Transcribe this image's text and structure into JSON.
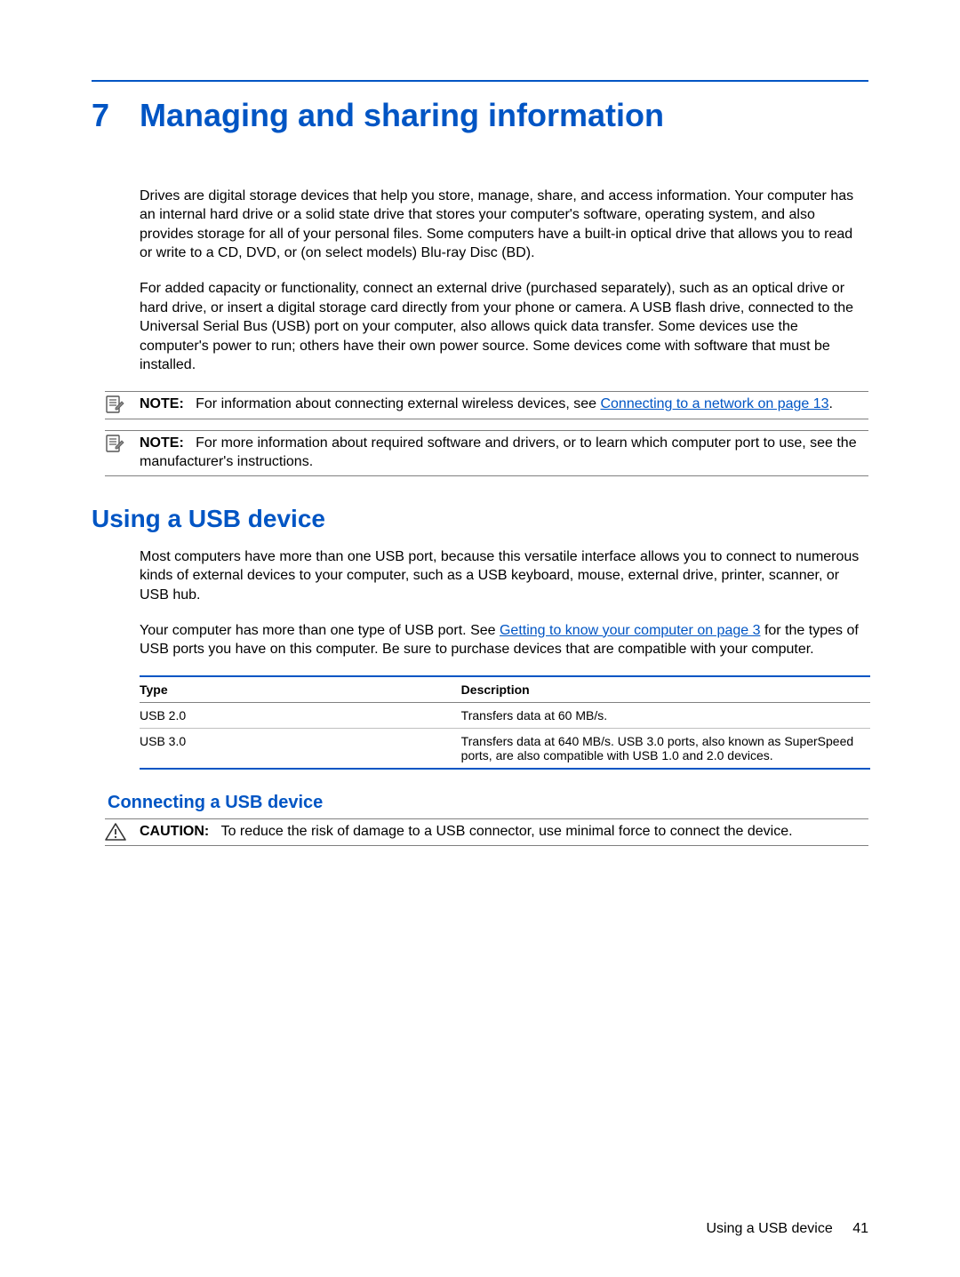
{
  "chapter": {
    "number": "7",
    "title": "Managing and sharing information"
  },
  "paragraphs": {
    "p1": "Drives are digital storage devices that help you store, manage, share, and access information. Your computer has an internal hard drive or a solid state drive that stores your computer's software, operating system, and also provides storage for all of your personal files. Some computers have a built-in optical drive that allows you to read or write to a CD, DVD, or (on select models) Blu-ray Disc (BD).",
    "p2": "For added capacity or functionality, connect an external drive (purchased separately), such as an optical drive or hard drive, or insert a digital storage card directly from your phone or camera. A USB flash drive, connected to the Universal Serial Bus (USB) port on your computer, also allows quick data transfer. Some devices use the computer's power to run; others have their own power source. Some devices come with software that must be installed."
  },
  "notes": [
    {
      "label": "NOTE:",
      "text_before": "For information about connecting external wireless devices, see ",
      "link": "Connecting to a network on page 13",
      "text_after": "."
    },
    {
      "label": "NOTE:",
      "text_full": "For more information about required software and drivers, or to learn which computer port to use, see the manufacturer's instructions."
    }
  ],
  "section_usb": {
    "heading": "Using a USB device",
    "p1": "Most computers have more than one USB port, because this versatile interface allows you to connect to numerous kinds of external devices to your computer, such as a USB keyboard, mouse, external drive, printer, scanner, or USB hub.",
    "p2_before": "Your computer has more than one type of USB port. See ",
    "p2_link": "Getting to know your computer on page 3",
    "p2_after": " for the types of USB ports you have on this computer. Be sure to purchase devices that are compatible with your computer."
  },
  "table": {
    "headers": {
      "type": "Type",
      "desc": "Description"
    },
    "rows": [
      {
        "type": "USB 2.0",
        "desc": "Transfers data at 60 MB/s."
      },
      {
        "type": "USB 3.0",
        "desc": "Transfers data at 640 MB/s. USB 3.0 ports, also known as SuperSpeed ports, are also compatible with USB 1.0 and 2.0 devices."
      }
    ]
  },
  "section_connect": {
    "heading": "Connecting a USB device",
    "caution_label": "CAUTION:",
    "caution_text": "To reduce the risk of damage to a USB connector, use minimal force to connect the device."
  },
  "footer": {
    "text": "Using a USB device",
    "page": "41"
  }
}
